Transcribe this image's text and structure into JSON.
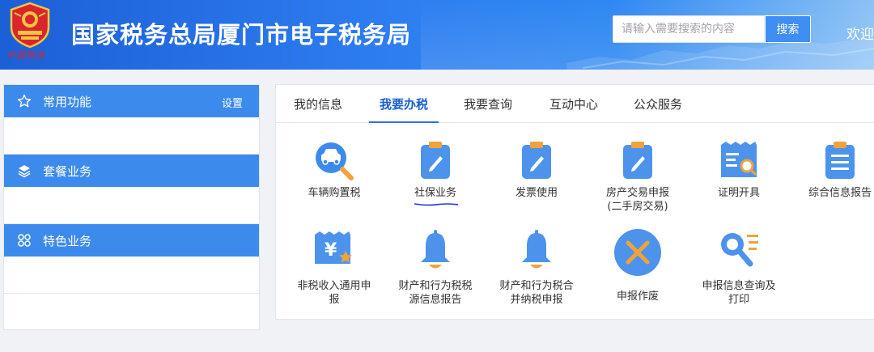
{
  "header": {
    "title": "国家税务总局厦门市电子税务局",
    "emblem_caption": "中国税务",
    "search": {
      "placeholder": "请输入需要搜索的内容",
      "button": "搜索"
    },
    "welcome": "欢迎",
    "colors": {
      "bar": "#2e7ef0",
      "search_button": "#3f8ef3"
    }
  },
  "sidebar": {
    "sections": [
      {
        "label": "常用功能",
        "icon": "star-icon",
        "action": "设置"
      },
      {
        "label": "套餐业务",
        "icon": "layers-icon"
      },
      {
        "label": "特色业务",
        "icon": "grid-icon"
      }
    ],
    "accent": "#3c8bec"
  },
  "main": {
    "tabs": [
      {
        "label": "我的信息",
        "active": false
      },
      {
        "label": "我要办税",
        "active": true
      },
      {
        "label": "我要查询",
        "active": false
      },
      {
        "label": "互动中心",
        "active": false
      },
      {
        "label": "公众服务",
        "active": false
      }
    ],
    "tiles": [
      {
        "label": "车辆购置税",
        "icon": "car-magnifier-icon"
      },
      {
        "label": "社保业务",
        "icon": "clipboard-pen-icon"
      },
      {
        "label": "发票使用",
        "icon": "clipboard-pen-icon"
      },
      {
        "label": "房产交易申报",
        "label2": "(二手房交易)",
        "icon": "clipboard-pen-icon"
      },
      {
        "label": "证明开具",
        "icon": "certificate-icon"
      },
      {
        "label": "综合信息报告",
        "icon": "document-list-icon"
      },
      {
        "label": "非税收入通用申",
        "label2": "报",
        "icon": "yen-ticket-star-icon"
      },
      {
        "label": "财产和行为税税",
        "label2": "源信息报告",
        "icon": "bell-icon"
      },
      {
        "label": "财产和行为税合",
        "label2": "并纳税申报",
        "icon": "bell-icon"
      },
      {
        "label": "申报作废",
        "icon": "cancel-circle-icon"
      },
      {
        "label": "申报信息查询及",
        "label2": "打印",
        "icon": "magnifier-list-icon"
      }
    ],
    "active_tab_color": "#1a5fcf"
  }
}
